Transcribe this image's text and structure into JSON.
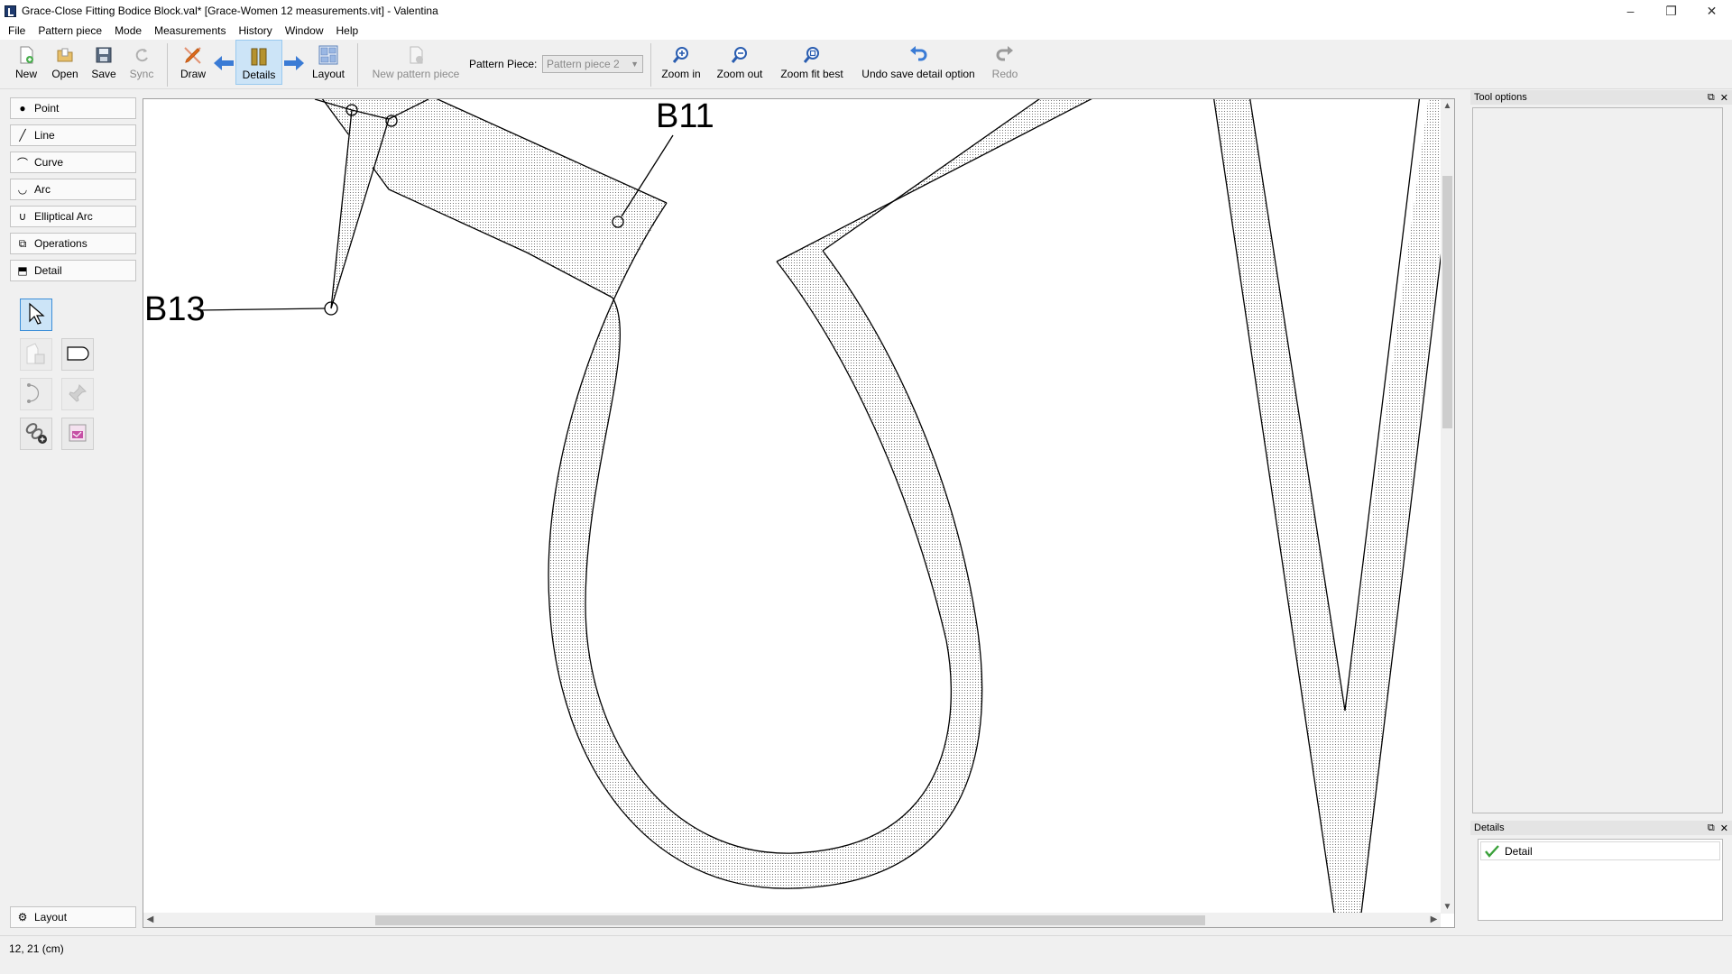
{
  "window": {
    "title": "Grace-Close Fitting Bodice Block.val* [Grace-Women 12 measurements.vit] - Valentina",
    "minimize": "–",
    "maximize": "❐",
    "close": "✕"
  },
  "menu": [
    "File",
    "Pattern piece",
    "Mode",
    "Measurements",
    "History",
    "Window",
    "Help"
  ],
  "toolbar": {
    "new_label": "New",
    "open_label": "Open",
    "save_label": "Save",
    "sync_label": "Sync",
    "draw_label": "Draw",
    "details_label": "Details",
    "layout_label": "Layout",
    "new_pattern_piece_label": "New pattern piece",
    "pattern_piece_label": "Pattern Piece:",
    "pattern_piece_value": "Pattern piece 2",
    "zoom_in_label": "Zoom in",
    "zoom_out_label": "Zoom out",
    "zoom_fit_label": "Zoom fit best",
    "undo_label": "Undo save detail option",
    "redo_label": "Redo"
  },
  "tool_categories": [
    {
      "label": "Point",
      "icon": "point-icon"
    },
    {
      "label": "Line",
      "icon": "line-icon"
    },
    {
      "label": "Curve",
      "icon": "curve-icon"
    },
    {
      "label": "Arc",
      "icon": "arc-icon"
    },
    {
      "label": "Elliptical Arc",
      "icon": "elliptical-arc-icon"
    },
    {
      "label": "Operations",
      "icon": "operations-icon"
    },
    {
      "label": "Detail",
      "icon": "detail-icon"
    }
  ],
  "layout_button": {
    "label": "Layout"
  },
  "canvas": {
    "point_labels": [
      "B11",
      "B13"
    ]
  },
  "docks": {
    "tool_options_title": "Tool options",
    "details_title": "Details",
    "details_items": [
      {
        "label": "Detail",
        "checked": true
      }
    ]
  },
  "status": {
    "cursor": "12, 21 (cm)"
  },
  "colors": {
    "accent": "#cce4f7",
    "accent_border": "#3b8ed8",
    "arrow_blue": "#3a7bd5",
    "draw_orange": "#f08c1e"
  }
}
